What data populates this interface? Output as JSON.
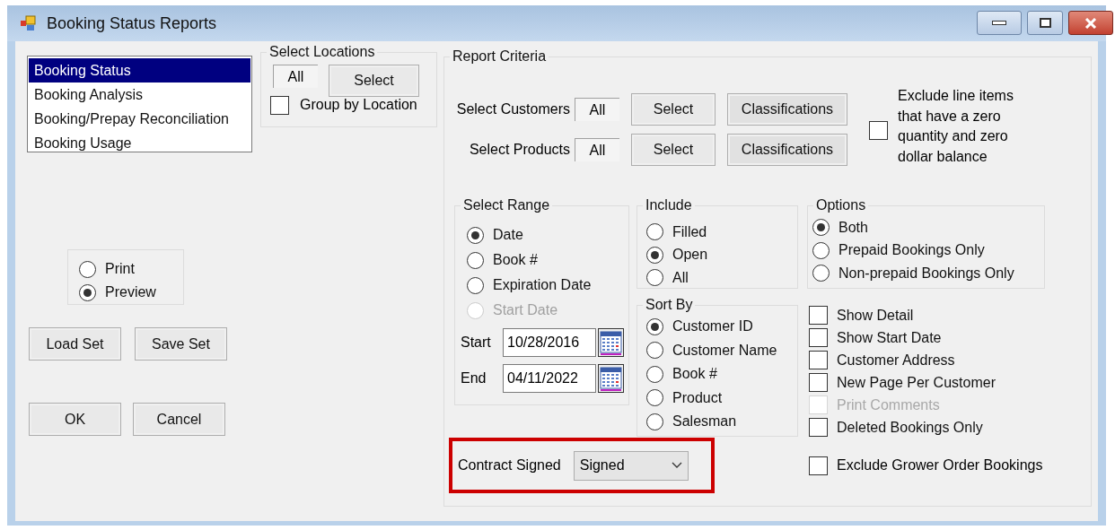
{
  "window": {
    "title": "Booking Status Reports"
  },
  "reports": [
    {
      "label": "Booking Status",
      "selected": true
    },
    {
      "label": "Booking Analysis",
      "selected": false
    },
    {
      "label": "Booking/Prepay Reconciliation",
      "selected": false
    },
    {
      "label": "Booking Usage",
      "selected": false
    }
  ],
  "output": [
    {
      "label": "Print",
      "selected": false
    },
    {
      "label": "Preview",
      "selected": true
    }
  ],
  "set_buttons": [
    "Load Set",
    "Save Set"
  ],
  "dialog_buttons": [
    "OK",
    "Cancel"
  ],
  "locations": {
    "title": "Select Locations",
    "value": "All",
    "button": "Select",
    "group_by": {
      "label": "Group by Location",
      "checked": false
    }
  },
  "criteria": {
    "title": "Report Criteria",
    "selectors": [
      {
        "label": "Select Customers",
        "value": "All",
        "buttons": [
          "Select",
          "Classifications"
        ]
      },
      {
        "label": "Select Products",
        "value": "All",
        "buttons": [
          "Select",
          "Classifications"
        ]
      }
    ],
    "exclude_zero": {
      "label": "Exclude line items that have a zero quantity and zero dollar balance",
      "checked": false
    },
    "range": {
      "title": "Select Range",
      "options": [
        {
          "label": "Date",
          "selected": true,
          "disabled": false
        },
        {
          "label": "Book #",
          "selected": false,
          "disabled": false
        },
        {
          "label": "Expiration Date",
          "selected": false,
          "disabled": false
        },
        {
          "label": "Start Date",
          "selected": false,
          "disabled": true
        }
      ],
      "dates": [
        {
          "label": "Start",
          "value": "10/28/2016"
        },
        {
          "label": "End",
          "value": "04/11/2022"
        }
      ]
    },
    "include": {
      "title": "Include",
      "options": [
        {
          "label": "Filled",
          "selected": false
        },
        {
          "label": "Open",
          "selected": true
        },
        {
          "label": "All",
          "selected": false
        }
      ]
    },
    "sort_by": {
      "title": "Sort By",
      "options": [
        {
          "label": "Customer ID",
          "selected": true
        },
        {
          "label": "Customer Name",
          "selected": false
        },
        {
          "label": "Book #",
          "selected": false
        },
        {
          "label": "Product",
          "selected": false
        },
        {
          "label": "Salesman",
          "selected": false
        }
      ]
    },
    "options": {
      "title": "Options",
      "options": [
        {
          "label": "Both",
          "selected": true
        },
        {
          "label": "Prepaid Bookings Only",
          "selected": false
        },
        {
          "label": "Non-prepaid Bookings Only",
          "selected": false
        }
      ]
    },
    "flags": [
      {
        "label": "Show Detail",
        "checked": false,
        "disabled": false
      },
      {
        "label": "Show Start Date",
        "checked": false,
        "disabled": false
      },
      {
        "label": "Customer Address",
        "checked": false,
        "disabled": false
      },
      {
        "label": "New Page Per Customer",
        "checked": false,
        "disabled": false
      },
      {
        "label": "Print Comments",
        "checked": false,
        "disabled": true
      },
      {
        "label": "Deleted Bookings Only",
        "checked": false,
        "disabled": false
      }
    ],
    "contract_signed": {
      "label": "Contract Signed",
      "value": "Signed",
      "highlighted": true
    },
    "exclude_grower": {
      "label": "Exclude Grower Order Bookings",
      "checked": false
    }
  }
}
